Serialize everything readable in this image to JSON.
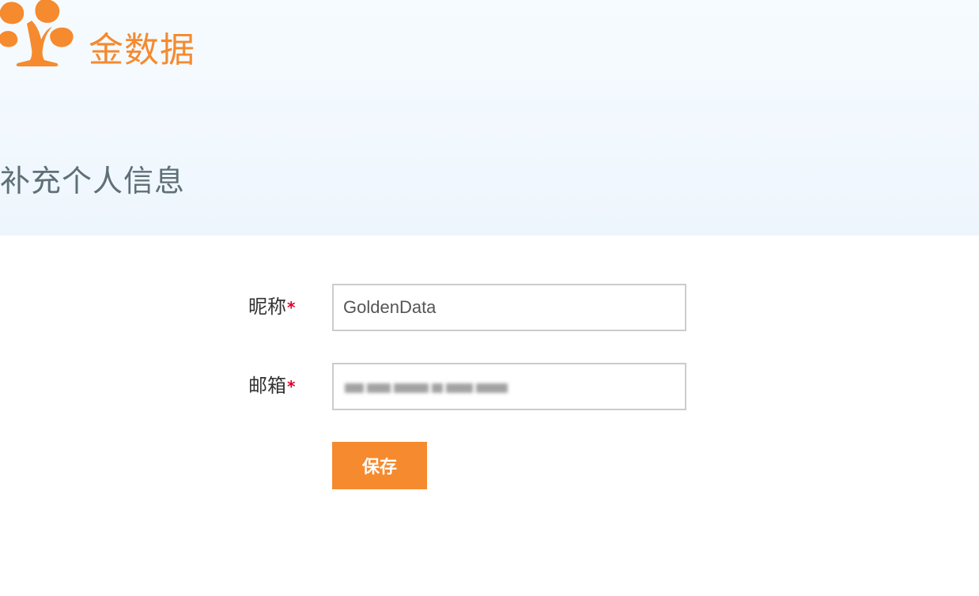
{
  "logo": {
    "icon": "tree-logo-icon",
    "text": "金数据",
    "color": "#f58a2e"
  },
  "page": {
    "title": "补充个人信息"
  },
  "form": {
    "nickname": {
      "label": "昵称",
      "required_mark": "*",
      "value": "GoldenData"
    },
    "email": {
      "label": "邮箱",
      "required_mark": "*",
      "value": ""
    },
    "save_label": "保存"
  },
  "colors": {
    "accent": "#f58a2e",
    "required": "#e0002a",
    "header_bg": "#f2f8fd"
  }
}
